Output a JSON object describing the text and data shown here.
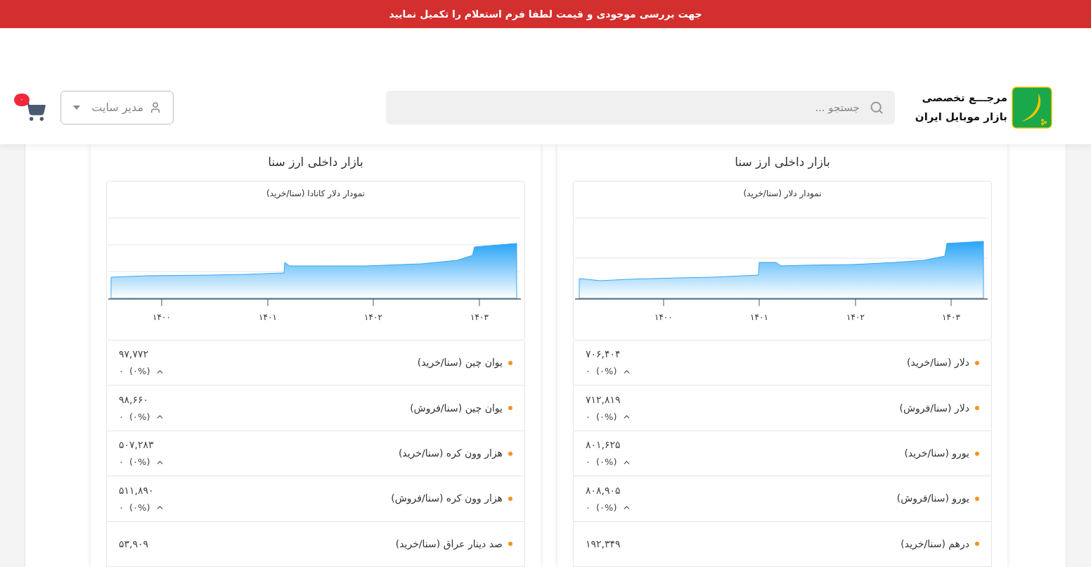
{
  "banner": {
    "text": "جهت بررسی موجودی و قیمت لطفا فرم استعلام را تکمیل نمایید"
  },
  "header": {
    "logo": {
      "line_1": "مرجـــع تخصصی",
      "line_2": "بازار موبایل ایران"
    },
    "search": {
      "placeholder": "جستجو ..."
    },
    "user_menu": {
      "label": "مدیر سایت"
    },
    "cart": {
      "badge": "۰"
    }
  },
  "panels": [
    {
      "title": "بازار داخلی ارز سنا",
      "chart": {
        "title": "نمودار دلار (سنا/خرید)",
        "axis_labels": [
          "۱۴۰۳",
          "۱۴۰۲",
          "۱۴۰۱",
          "۱۴۰۰"
        ]
      },
      "rows": [
        {
          "name": "دلار (سنا/خرید)",
          "price": "۷۰۶,۴۰۴",
          "change": "۰",
          "percent": "(۰%)",
          "kind": "up"
        },
        {
          "name": "دلار (سنا/فروش)",
          "price": "۷۱۲,۸۱۹",
          "change": "۰",
          "percent": "(۰%)",
          "kind": "up"
        },
        {
          "name": "یورو (سنا/خرید)",
          "price": "۸۰۱,۶۲۵",
          "change": "۰",
          "percent": "(۰%)",
          "kind": "up"
        },
        {
          "name": "یورو (سنا/فروش)",
          "price": "۸۰۸,۹۰۵",
          "change": "۰",
          "percent": "(۰%)",
          "kind": "up"
        },
        {
          "name": "درهم (سنا/خرید)",
          "price": "۱۹۲,۳۴۹"
        }
      ]
    },
    {
      "title": "بازار داخلی ارز سنا",
      "chart": {
        "title": "نمودار دلار کانادا (سنا/خرید)",
        "axis_labels": [
          "۱۴۰۳",
          "۱۴۰۲",
          "۱۴۰۱",
          "۱۴۰۰"
        ]
      },
      "rows": [
        {
          "name": "یوان چین (سنا/خرید)",
          "price": "۹۷,۷۷۲",
          "change": "۰",
          "percent": "(۰%)",
          "kind": "up"
        },
        {
          "name": "یوان چین (سنا/فروش)",
          "price": "۹۸,۶۶۰",
          "change": "۰",
          "percent": "(۰%)",
          "kind": "up"
        },
        {
          "name": "هزار وون کره (سنا/خرید)",
          "price": "۵۰۷,۲۸۳",
          "change": "۰",
          "percent": "(۰%)",
          "kind": "up"
        },
        {
          "name": "هزار وون کره (سنا/فروش)",
          "price": "۵۱۱,۸۹۰",
          "change": "۰",
          "percent": "(۰%)",
          "kind": "up"
        },
        {
          "name": "صد دینار عراق (سنا/خرید)",
          "price": "۵۳,۹۰۹"
        }
      ]
    }
  ]
}
